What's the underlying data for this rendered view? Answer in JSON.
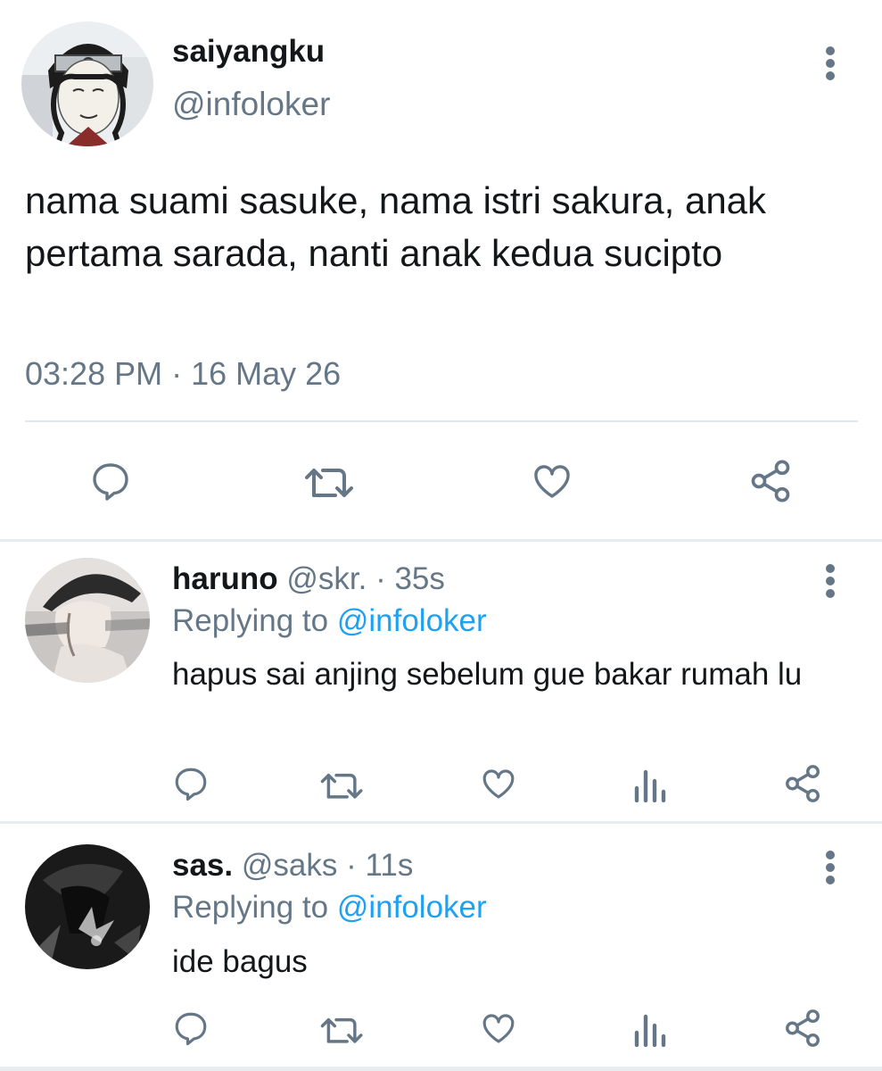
{
  "tweet": {
    "display_name": "saiyangku",
    "handle": "@infoloker",
    "text": "nama suami sasuke, nama istri sakura, anak pertama sarada, nanti anak kedua sucipto",
    "timestamp": "03:28 PM · 16 May 26",
    "actions": [
      "reply-icon",
      "retweet-icon",
      "like-icon",
      "share-icon"
    ]
  },
  "replies": [
    {
      "display_name": "haruno",
      "handle": "@skr.",
      "separator": "·",
      "time": "35s",
      "replying_prefix": "Replying to",
      "replying_to": "@infoloker",
      "text": "hapus sai anjing sebelum gue bakar rumah lu",
      "actions": [
        "reply-icon",
        "retweet-icon",
        "like-icon",
        "analytics-icon",
        "share-icon"
      ]
    },
    {
      "display_name": "sas.",
      "handle": "@saks",
      "separator": "·",
      "time": "11s",
      "replying_prefix": "Replying to",
      "replying_to": "@infoloker",
      "text": "ide bagus",
      "actions": [
        "reply-icon",
        "retweet-icon",
        "like-icon",
        "analytics-icon",
        "share-icon"
      ]
    }
  ],
  "colors": {
    "text_primary": "#14171a",
    "text_secondary": "#657786",
    "accent": "#1da1f2",
    "divider": "#e1e8ed"
  }
}
